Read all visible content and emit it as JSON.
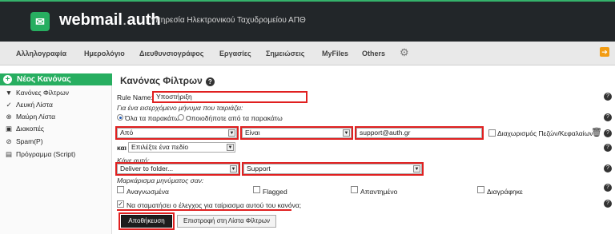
{
  "header": {
    "brand_main": "webmail",
    "brand_dot": ".",
    "brand_suffix": "auth",
    "tagline": "| Υπηρεσία Ηλεκτρονικού Ταχυδρομείου ΑΠΘ",
    "accent_color": "#27ae60"
  },
  "menu": {
    "items": [
      "Αλληλογραφία",
      "Ημερολόγιο",
      "Διευθυνσιογράφος",
      "Εργασίες",
      "Σημειώσεις",
      "MyFiles",
      "Others"
    ],
    "gear_icon": "gear-icon",
    "logout_icon": "logout-icon"
  },
  "sidebar": {
    "new_rule": "Νέος Κανόνας",
    "items": [
      {
        "label": "Κανόνες Φίλτρων",
        "icon": "filter-icon"
      },
      {
        "label": "Λευκή Λίστα",
        "icon": "check-circle-icon"
      },
      {
        "label": "Μαύρη Λίστα",
        "icon": "block-circle-icon"
      },
      {
        "label": "Διακοπές",
        "icon": "vacation-icon"
      },
      {
        "label": "Spam(P)",
        "icon": "spam-icon"
      },
      {
        "label": "Πρόγραμμα (Script)",
        "icon": "script-icon"
      }
    ]
  },
  "form": {
    "title": "Κανόνας Φίλτρων",
    "rule_name_label": "Rule Name:",
    "rule_name_value": "Υποστήριξη",
    "incoming_hint": "Για ένα εισερχόμενο μήνυμα που ταιριάζει:",
    "match_all": "Όλα τα παρακάτω",
    "match_any": "Οποιοδήποτε από τα παρακάτω",
    "criterion_field": "Από",
    "criterion_op": "Είναι",
    "criterion_value": "support@auth.gr",
    "case_sensitive_label": "Διαχωρισμός Πεζών/Κεφαλαίων",
    "and_label": "και",
    "choose_field": "Επιλέξτε ένα πεδίο",
    "do_this": "Κάνε αυτό:",
    "action": "Deliver to folder...",
    "folder": "Support",
    "mark_as": "Μαρκάρισμα μηνύματος σαν:",
    "flags": [
      "Αναγνωσμένα",
      "Flagged",
      "Απαντημένο",
      "Διαγράφηκε"
    ],
    "stop_checking": "Να σταματήσει ο έλεγχος για ταίριασμα αυτού του κανόνα;",
    "save": "Αποθήκευση",
    "back": "Επιστροφή στη Λίστα Φίλτρων"
  }
}
